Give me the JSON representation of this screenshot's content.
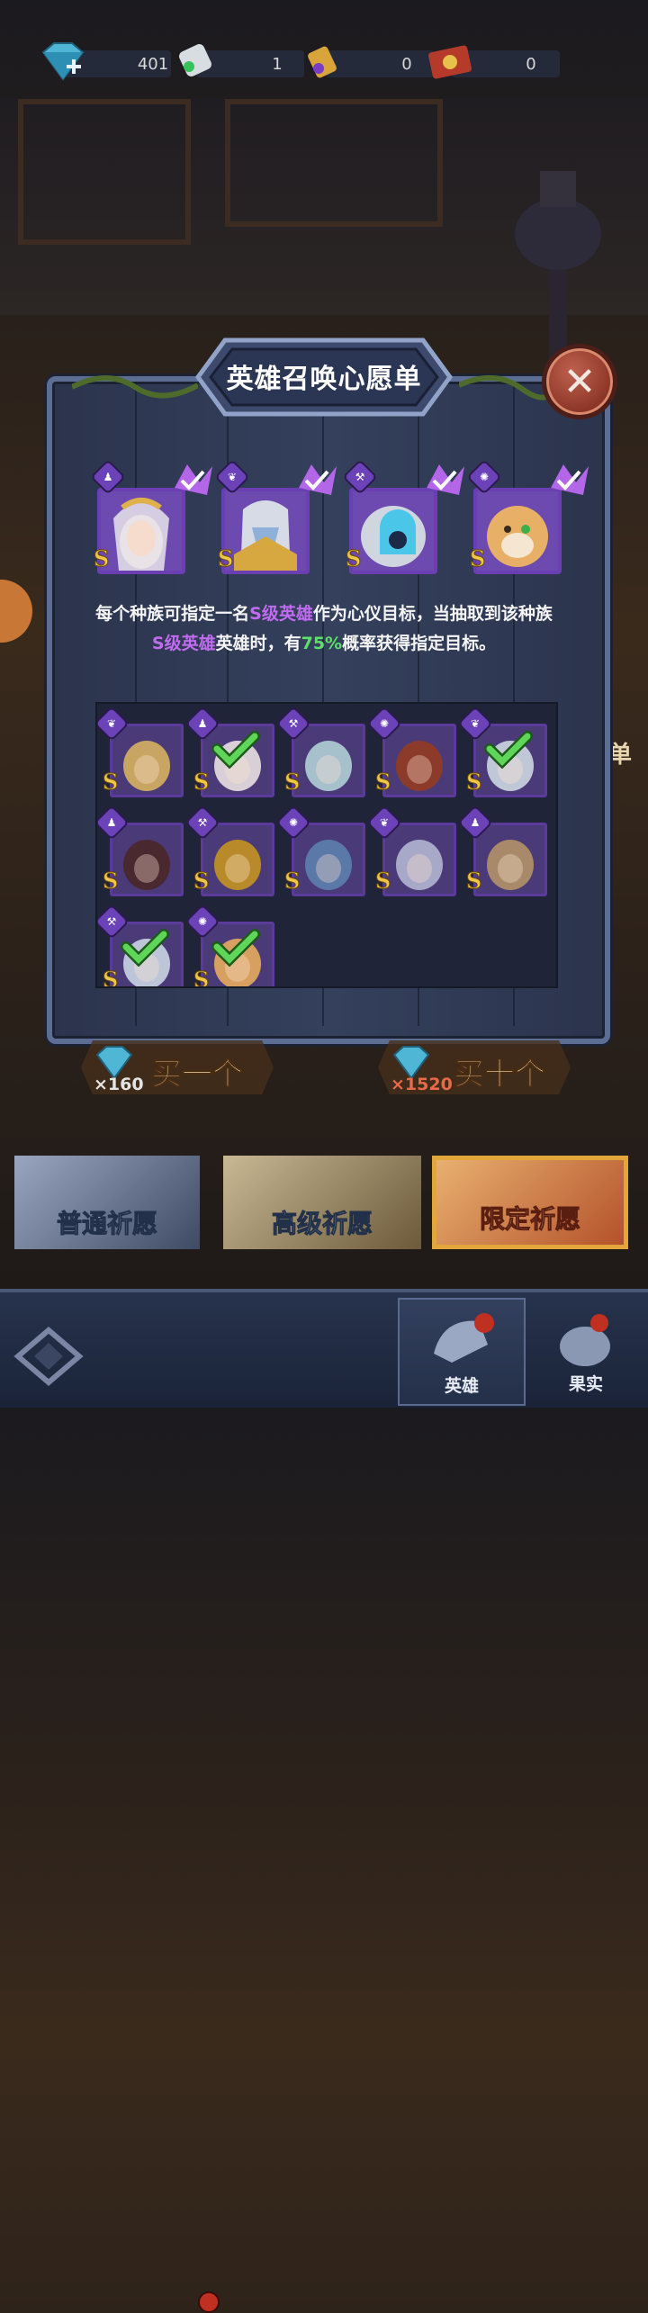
{
  "currencies": [
    {
      "icon": "diamond-icon",
      "value": "401"
    },
    {
      "icon": "scroll-ticket-icon",
      "value": "1"
    },
    {
      "icon": "purple-scroll-icon",
      "value": "0"
    },
    {
      "icon": "red-scroll-icon",
      "value": "0"
    }
  ],
  "panel": {
    "title": "英雄召唤心愿单",
    "wish_slots": [
      {
        "race": "priest",
        "rank": "S",
        "selected": true
      },
      {
        "race": "wing",
        "rank": "S",
        "selected": true
      },
      {
        "race": "mech",
        "rank": "S",
        "selected": true
      },
      {
        "race": "beast",
        "rank": "S",
        "selected": true
      }
    ],
    "description": {
      "part1": "每个种族可指定一名",
      "highlight1": "S级英雄",
      "part2": "作为心仪目标，当抽取到该种族",
      "highlight2": "S级英雄",
      "part3": "英雄时，有",
      "percent": "75%",
      "part4": "概率获得指定目标。"
    },
    "heroes": [
      {
        "race": "wing",
        "rank": "S",
        "checked": false,
        "palette": "#c9a564"
      },
      {
        "race": "priest",
        "rank": "S",
        "checked": true,
        "palette": "#d8d0d6"
      },
      {
        "race": "mech",
        "rank": "S",
        "checked": false,
        "palette": "#a6c0cc"
      },
      {
        "race": "beast",
        "rank": "S",
        "checked": false,
        "palette": "#8c3a2a"
      },
      {
        "race": "wing",
        "rank": "S",
        "checked": true,
        "palette": "#c0c8d8"
      },
      {
        "race": "priest",
        "rank": "S",
        "checked": false,
        "palette": "#4a2830"
      },
      {
        "race": "mech",
        "rank": "S",
        "checked": false,
        "palette": "#b88a2a"
      },
      {
        "race": "beast",
        "rank": "S",
        "checked": false,
        "palette": "#5a78a8"
      },
      {
        "race": "wing",
        "rank": "S",
        "checked": false,
        "palette": "#a8a8c8"
      },
      {
        "race": "priest",
        "rank": "S",
        "checked": false,
        "palette": "#a88a6a"
      },
      {
        "race": "mech",
        "rank": "S",
        "checked": true,
        "palette": "#bcc6d8"
      },
      {
        "race": "beast",
        "rank": "S",
        "checked": true,
        "palette": "#d8a060"
      }
    ]
  },
  "buy": {
    "single": {
      "cost": "×160",
      "label": "买一个"
    },
    "ten": {
      "cost": "×1520",
      "label": "买十个"
    }
  },
  "banners": [
    {
      "label": "普通祈愿",
      "has_dot": true
    },
    {
      "label": "高级祈愿",
      "has_dot": false
    },
    {
      "label": "限定祈愿",
      "has_dot": false,
      "active": true
    }
  ],
  "side_text": "单",
  "nav": [
    {
      "label": "英雄",
      "icon": "hero-helmet-icon",
      "active": true
    },
    {
      "label": "果实",
      "icon": "fruit-icon",
      "active": false
    }
  ],
  "colors": {
    "purple_highlight": "#c06bf0",
    "green_highlight": "#5fe06a",
    "rank_gold": "#f0c64a"
  }
}
